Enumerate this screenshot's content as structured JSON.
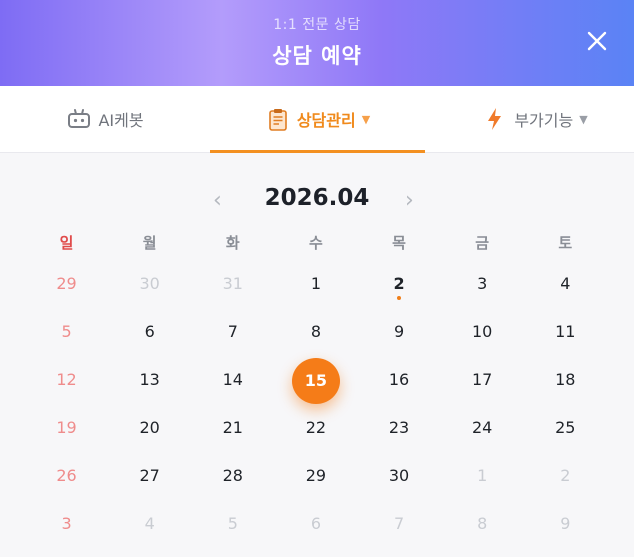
{
  "header": {
    "subtitle": "1:1 전문 상담",
    "title": "상담 예약"
  },
  "tabs": [
    {
      "label": "AI케봇",
      "icon": "robot-icon"
    },
    {
      "label": "상담관리",
      "icon": "clipboard-icon",
      "active": true
    },
    {
      "label": "부가기능",
      "icon": "lightning-icon"
    }
  ],
  "calendar": {
    "month_label": "2026.04",
    "prev_label": "‹",
    "next_label": "›",
    "weekdays": [
      "일",
      "월",
      "화",
      "수",
      "목",
      "금",
      "토"
    ],
    "weeks": [
      [
        "29",
        "30",
        "31",
        "1",
        "2",
        "3",
        "4"
      ],
      [
        "5",
        "6",
        "7",
        "8",
        "9",
        "10",
        "11"
      ],
      [
        "12",
        "13",
        "14",
        "15",
        "16",
        "17",
        "18"
      ],
      [
        "19",
        "20",
        "21",
        "22",
        "23",
        "24",
        "25"
      ],
      [
        "26",
        "27",
        "28",
        "29",
        "30",
        "1",
        "2"
      ],
      [
        "3",
        "4",
        "5",
        "6",
        "7",
        "8",
        "9"
      ]
    ],
    "selected": "15",
    "marked": "2"
  },
  "colors": {
    "accent": "#f57c18",
    "sunday": "#e04b4b",
    "header_gradient": [
      "#7e6cf4",
      "#b39cfb",
      "#5a83f5"
    ]
  }
}
